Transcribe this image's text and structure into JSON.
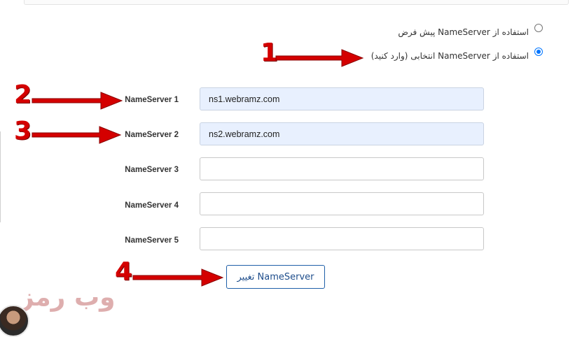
{
  "options": {
    "default_label": "استفاده از NameServer پیش فرض",
    "default_checked": false,
    "custom_label": "استفاده از NameServer انتخابی (وارد کنید)",
    "custom_checked": true
  },
  "fields": [
    {
      "label": "NameServer 1",
      "value": "ns1.webramz.com"
    },
    {
      "label": "NameServer 2",
      "value": "ns2.webramz.com"
    },
    {
      "label": "NameServer 3",
      "value": ""
    },
    {
      "label": "NameServer 4",
      "value": ""
    },
    {
      "label": "NameServer 5",
      "value": ""
    }
  ],
  "submit": {
    "label": "تغییر NameServer"
  },
  "markers": [
    "1",
    "2",
    "3",
    "4"
  ],
  "logo_text": "وب رمز",
  "colors": {
    "annotation": "#d40000",
    "button_border": "#1f5fa8",
    "filled_input": "#e8f0fe"
  }
}
